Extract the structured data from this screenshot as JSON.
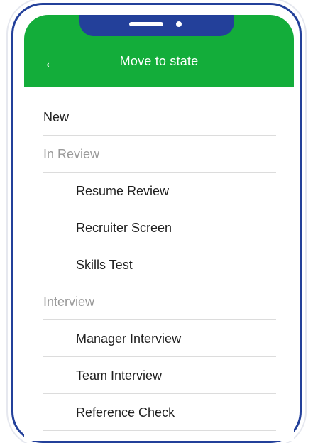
{
  "header": {
    "title": "Move to state",
    "back_icon": "←"
  },
  "list": [
    {
      "kind": "top",
      "label": "New"
    },
    {
      "kind": "section",
      "label": "In Review"
    },
    {
      "kind": "child",
      "label": "Resume Review"
    },
    {
      "kind": "child",
      "label": "Recruiter Screen"
    },
    {
      "kind": "child",
      "label": "Skills Test"
    },
    {
      "kind": "section",
      "label": "Interview"
    },
    {
      "kind": "child",
      "label": "Manager Interview"
    },
    {
      "kind": "child",
      "label": "Team Interview"
    },
    {
      "kind": "child",
      "label": "Reference Check"
    }
  ],
  "colors": {
    "header_bg": "#13ad3a",
    "frame": "#23409a",
    "section_text": "#9a9a9a"
  }
}
